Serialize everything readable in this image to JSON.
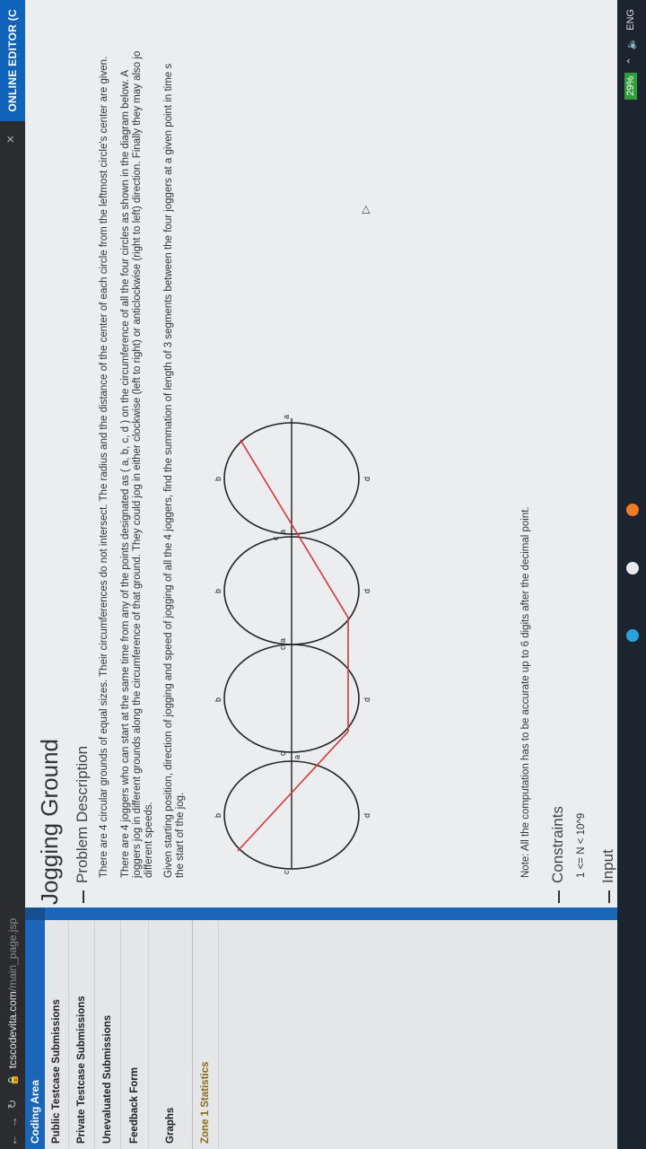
{
  "browser": {
    "domain": "tcscodevita.com",
    "path": "/main_page.jsp",
    "editor_button": "ONLINE EDITOR (C"
  },
  "sidebar": {
    "header": "Coding Area",
    "items": [
      {
        "label": "Public Testcase Submissions"
      },
      {
        "label": "Private Testcase Submissions"
      },
      {
        "label": "Unevaluated Submissions"
      },
      {
        "label": "Feedback Form"
      },
      {
        "label": "Graphs"
      },
      {
        "label": "Zone 1 Statistics"
      }
    ]
  },
  "problem": {
    "title": "Jogging Ground",
    "description_heading": "Problem Description",
    "para1": "There are 4 circular grounds of equal sizes. Their circumferences do not intersect. The radius and the distance of the center of each circle from the leftmost circle's center are given.",
    "para2_line1": "There are 4 joggers who can start at the same time from any of the points designated as ( a, b, c, d ) on the circumference of all the four circles as shown in the diagram below. A",
    "para2_line2": "joggers jog in different grounds along the circumference of that ground. They could jog in either clockwise (left to right) or anticlockwise (right to left) direction. Finally they may also jo",
    "para2_line3": "different speeds.",
    "para3_line1": "Given starting position, direction of jogging and speed of jogging of all the 4 joggers, find the summation of length of 3 segments between the four joggers at a given point in time s",
    "para3_line2": "the start of the jog.",
    "note": "Note: All the computation has to be accurate up to 6 digits after the decimal point.",
    "constraints_heading": "Constraints",
    "constraint1": "1 <= N < 10^9",
    "input_heading": "Input"
  },
  "diagram_labels": {
    "a": "a",
    "b": "b",
    "c": "c",
    "d": "d"
  },
  "tray": {
    "battery": "29%",
    "lang": "ENG"
  },
  "colors": {
    "accent": "#1a66b8",
    "red_segment": "#d9363e"
  }
}
